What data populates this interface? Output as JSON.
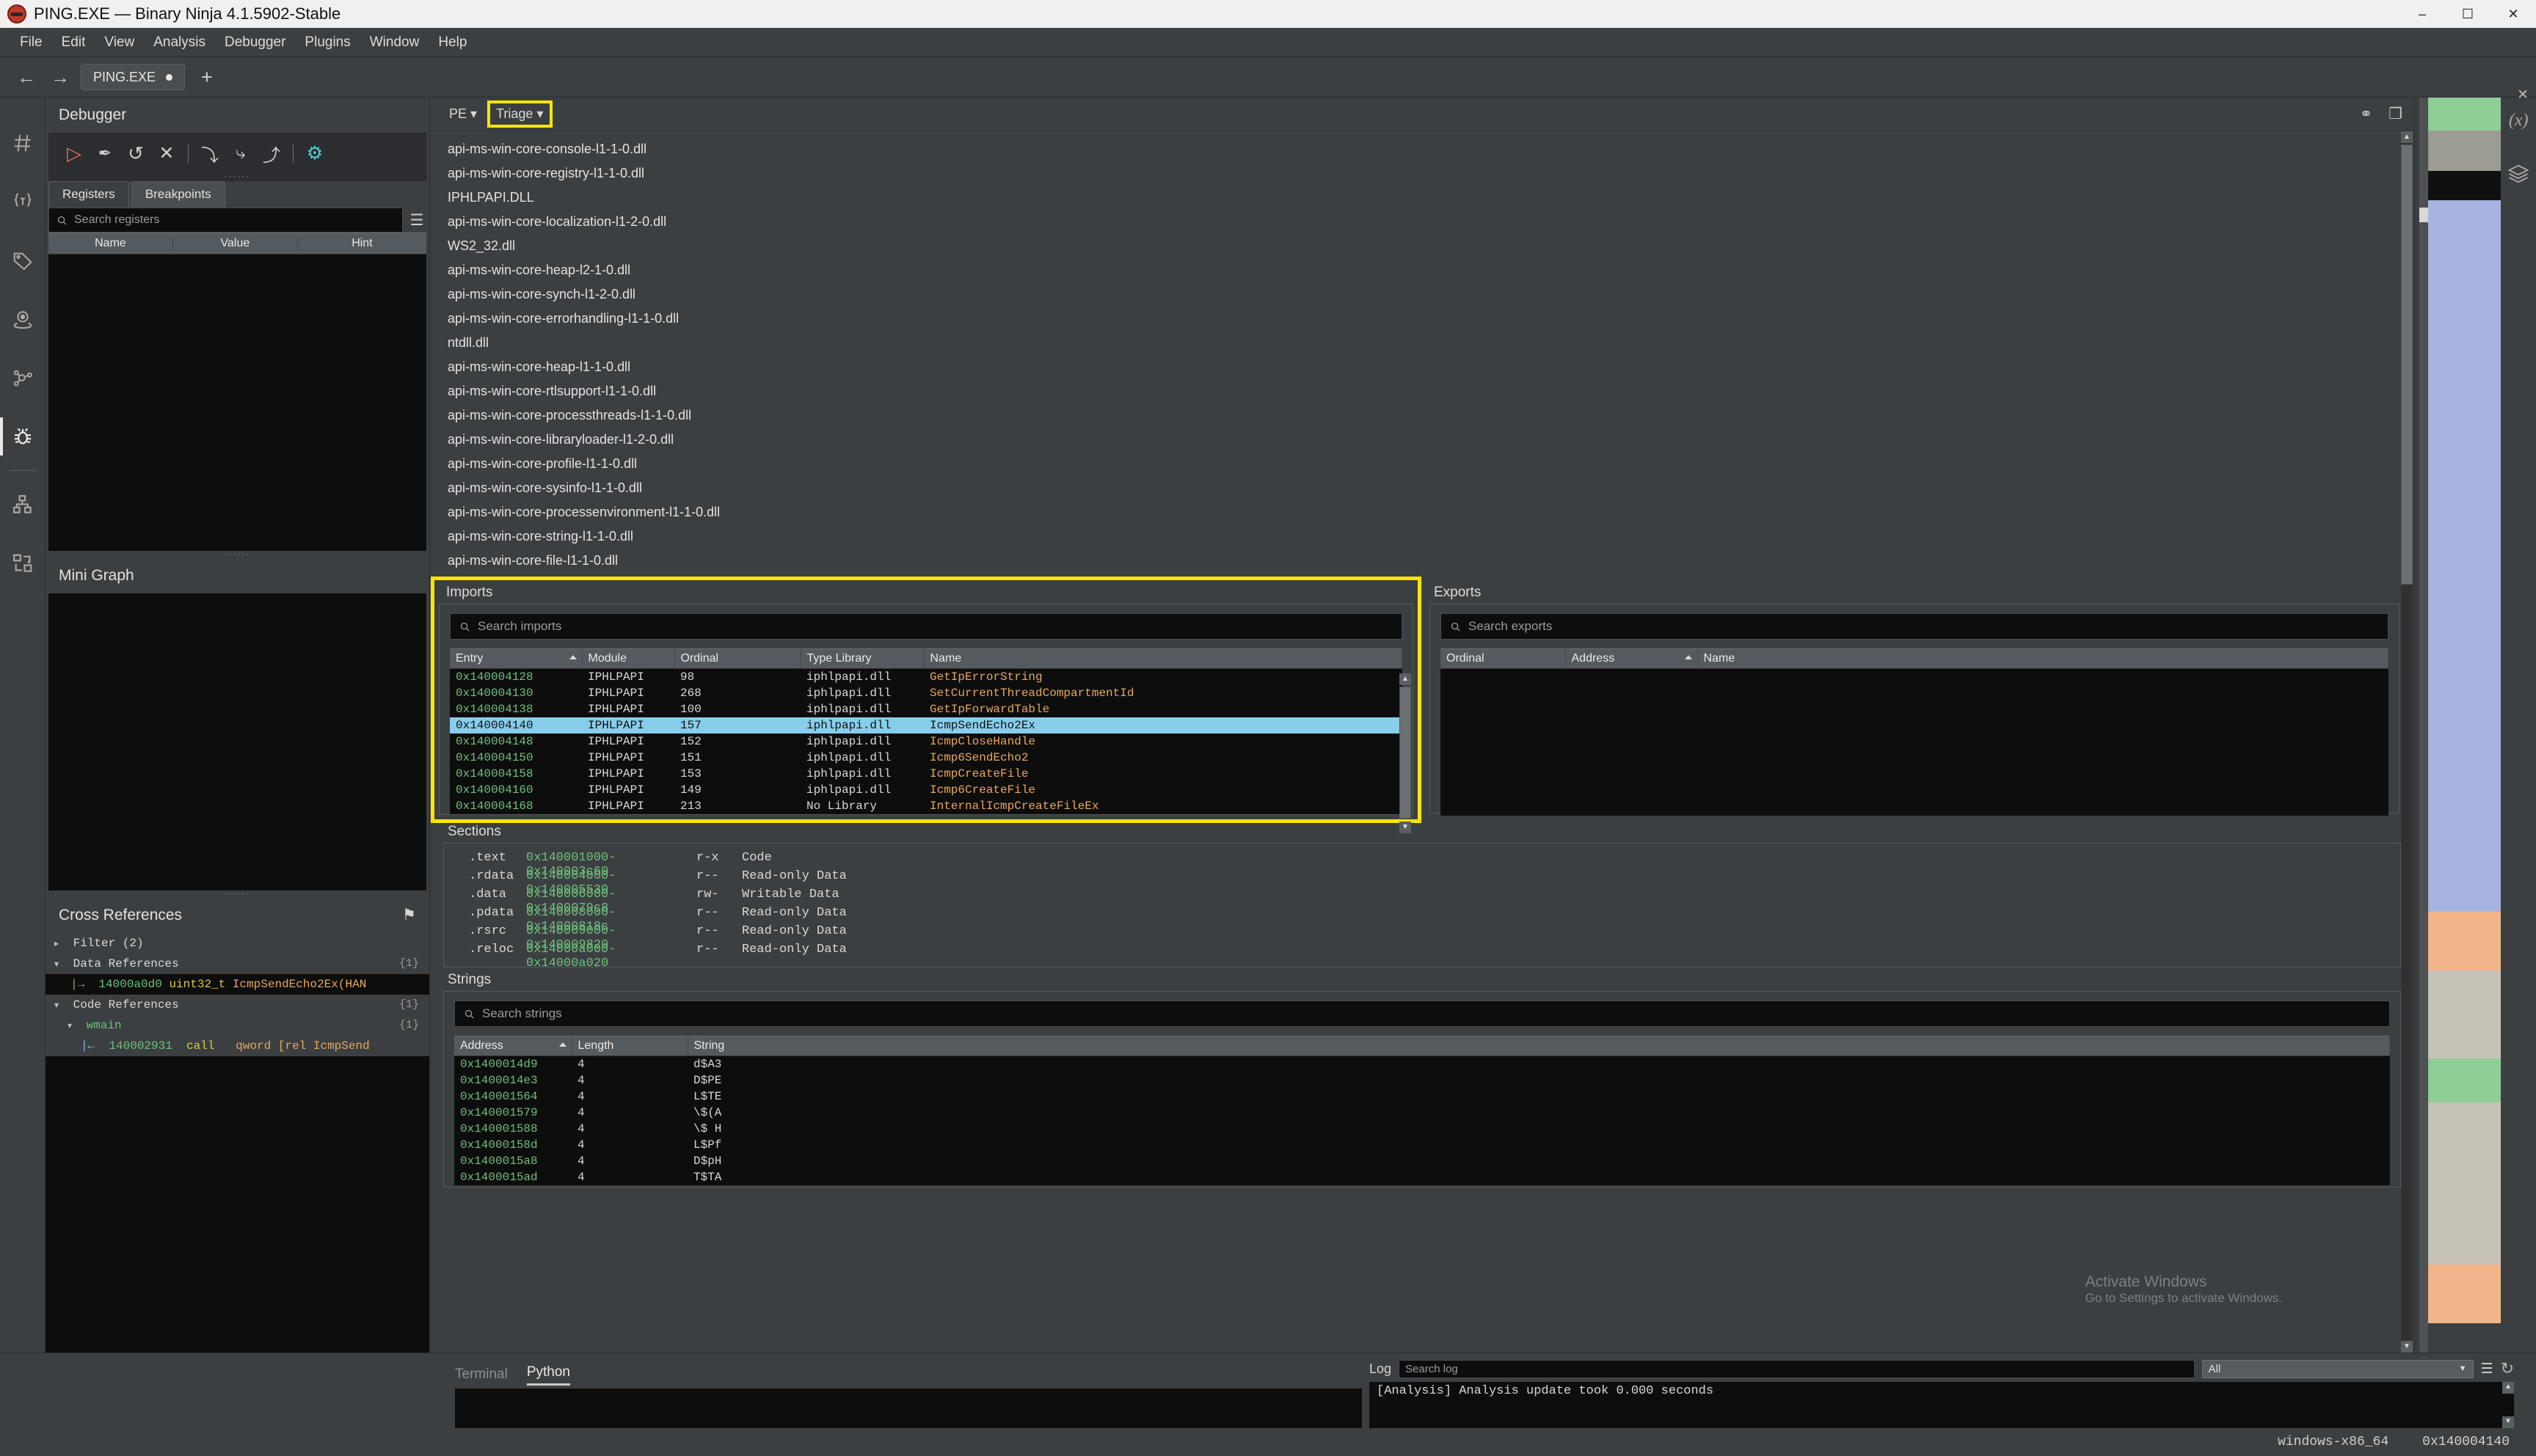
{
  "window": {
    "title": "PING.EXE — Binary Ninja 4.1.5902-Stable",
    "icon": "ninja-logo-icon",
    "minimize": "–",
    "maximize": "☐",
    "close": "✕"
  },
  "menubar": {
    "items": [
      "File",
      "Edit",
      "View",
      "Analysis",
      "Debugger",
      "Plugins",
      "Window",
      "Help"
    ]
  },
  "tabstrip": {
    "back": "←",
    "forward": "→",
    "file_tab": "PING.EXE",
    "new_tab": "+"
  },
  "icon_rail": {
    "items": [
      {
        "name": "symbols-icon",
        "glyph": "♯",
        "active": false
      },
      {
        "name": "types-icon",
        "glyph": "{T}",
        "active": false
      },
      {
        "name": "tags-icon",
        "glyph": "◇",
        "active": false
      },
      {
        "name": "location-icon",
        "glyph": "◎",
        "active": false
      },
      {
        "name": "graph-nodes-icon",
        "glyph": "∴",
        "active": false
      },
      {
        "name": "debugger-icon",
        "glyph": "☣",
        "active": true
      },
      {
        "name": "hierarchy-icon",
        "glyph": "☷",
        "active": false
      },
      {
        "name": "transform-icon",
        "glyph": "⇄",
        "active": false
      }
    ]
  },
  "debugger_panel": {
    "title": "Debugger",
    "toolbar": [
      {
        "name": "run-button",
        "glyph": "▷",
        "color": "#e06c5c"
      },
      {
        "name": "connect-button",
        "glyph": "✒",
        "color": "#d5d5d5"
      },
      {
        "name": "restart-button",
        "glyph": "↺",
        "color": "#cdcdcd"
      },
      {
        "name": "stop-button",
        "glyph": "✕",
        "color": "#cdcdcd"
      },
      {
        "name": "step-into-button",
        "glyph": "⤵",
        "color": "#cdcdcd"
      },
      {
        "name": "step-over-button",
        "glyph": "⤷",
        "color": "#cdcdcd"
      },
      {
        "name": "step-out-button",
        "glyph": "⤴",
        "color": "#cdcdcd"
      },
      {
        "name": "settings-gear-button",
        "glyph": "⚙",
        "color": "#4fd0d0"
      }
    ],
    "tabs": [
      {
        "label": "Registers",
        "selected": true
      },
      {
        "label": "Breakpoints",
        "selected": false
      }
    ],
    "search_placeholder": "Search registers",
    "menu_glyph": "☰",
    "columns": [
      "Name",
      "Value",
      "Hint"
    ],
    "rows": []
  },
  "mini_graph": {
    "title": "Mini Graph"
  },
  "cross_references": {
    "title": "Cross References",
    "pin_icon": "⚑",
    "filter_label": "Filter",
    "filter_count": "(2)",
    "groups": [
      {
        "label": "Data References",
        "count": "{1}",
        "rows": [
          {
            "arrow": "|→",
            "address": "14000a0d0",
            "type": "uint32_t",
            "symbol": "IcmpSendEcho2Ex(HAN",
            "selected": true
          }
        ]
      },
      {
        "label": "Code References",
        "count": "{1}",
        "subgroup": "wmain",
        "subgroup_count": "{1}",
        "rows": [
          {
            "arrow": "|←",
            "address": "140002931",
            "mnemonic": "call",
            "operand": "qword [rel IcmpSend",
            "selected": false
          }
        ]
      }
    ]
  },
  "view_bar": {
    "view_type": "PE",
    "view_type_caret": "▾",
    "view_mode": "Triage",
    "view_mode_caret": "▾",
    "view_mode_highlighted": true,
    "link_icon": "⚭",
    "split_icon": "❐"
  },
  "triage": {
    "libraries": [
      "api-ms-win-core-console-l1-1-0.dll",
      "api-ms-win-core-registry-l1-1-0.dll",
      "IPHLPAPI.DLL",
      "api-ms-win-core-localization-l1-2-0.dll",
      "WS2_32.dll",
      "api-ms-win-core-heap-l2-1-0.dll",
      "api-ms-win-core-synch-l1-2-0.dll",
      "api-ms-win-core-errorhandling-l1-1-0.dll",
      "ntdll.dll",
      "api-ms-win-core-heap-l1-1-0.dll",
      "api-ms-win-core-rtlsupport-l1-1-0.dll",
      "api-ms-win-core-processthreads-l1-1-0.dll",
      "api-ms-win-core-libraryloader-l1-2-0.dll",
      "api-ms-win-core-profile-l1-1-0.dll",
      "api-ms-win-core-sysinfo-l1-1-0.dll",
      "api-ms-win-core-processenvironment-l1-1-0.dll",
      "api-ms-win-core-string-l1-1-0.dll",
      "api-ms-win-core-file-l1-1-0.dll"
    ],
    "imports": {
      "title": "Imports",
      "highlighted": true,
      "search_placeholder": "Search imports",
      "columns": [
        "Entry",
        "Module",
        "Ordinal",
        "Type Library",
        "Name"
      ],
      "sorted_column": "Entry",
      "rows": [
        {
          "entry": "0x140004128",
          "module": "IPHLPAPI",
          "ordinal": "98",
          "typelib": "iphlpapi.dll",
          "name": "GetIpErrorString",
          "selected": false
        },
        {
          "entry": "0x140004130",
          "module": "IPHLPAPI",
          "ordinal": "268",
          "typelib": "iphlpapi.dll",
          "name": "SetCurrentThreadCompartmentId",
          "selected": false
        },
        {
          "entry": "0x140004138",
          "module": "IPHLPAPI",
          "ordinal": "100",
          "typelib": "iphlpapi.dll",
          "name": "GetIpForwardTable",
          "selected": false
        },
        {
          "entry": "0x140004140",
          "module": "IPHLPAPI",
          "ordinal": "157",
          "typelib": "iphlpapi.dll",
          "name": "IcmpSendEcho2Ex",
          "selected": true
        },
        {
          "entry": "0x140004148",
          "module": "IPHLPAPI",
          "ordinal": "152",
          "typelib": "iphlpapi.dll",
          "name": "IcmpCloseHandle",
          "selected": false
        },
        {
          "entry": "0x140004150",
          "module": "IPHLPAPI",
          "ordinal": "151",
          "typelib": "iphlpapi.dll",
          "name": "Icmp6SendEcho2",
          "selected": false
        },
        {
          "entry": "0x140004158",
          "module": "IPHLPAPI",
          "ordinal": "153",
          "typelib": "iphlpapi.dll",
          "name": "IcmpCreateFile",
          "selected": false
        },
        {
          "entry": "0x140004160",
          "module": "IPHLPAPI",
          "ordinal": "149",
          "typelib": "iphlpapi.dll",
          "name": "Icmp6CreateFile",
          "selected": false
        },
        {
          "entry": "0x140004168",
          "module": "IPHLPAPI",
          "ordinal": "213",
          "typelib": "No Library",
          "name": "InternalIcmpCreateFileEx",
          "selected": false
        }
      ]
    },
    "exports": {
      "title": "Exports",
      "search_placeholder": "Search exports",
      "columns": [
        "Ordinal",
        "Address",
        "Name"
      ],
      "sorted_column": "Address",
      "rows": []
    },
    "sections": {
      "title": "Sections",
      "rows": [
        {
          "name": ".text",
          "range": "0x140001000-0x140003c60",
          "perms": "r-x",
          "desc": "Code"
        },
        {
          "name": ".rdata",
          "range": "0x140004000-0x140005530",
          "perms": "r--",
          "desc": "Read-only Data"
        },
        {
          "name": ".data",
          "range": "0x140006000-0x1400079c8",
          "perms": "rw-",
          "desc": "Writable Data"
        },
        {
          "name": ".pdata",
          "range": "0x140008000-0x14000818c",
          "perms": "r--",
          "desc": "Read-only Data"
        },
        {
          "name": ".rsrc",
          "range": "0x140009000-0x140009820",
          "perms": "r--",
          "desc": "Read-only Data"
        },
        {
          "name": ".reloc",
          "range": "0x14000a000-0x14000a020",
          "perms": "r--",
          "desc": "Read-only Data"
        }
      ]
    },
    "strings": {
      "title": "Strings",
      "search_placeholder": "Search strings",
      "columns": [
        "Address",
        "Length",
        "String"
      ],
      "sorted_column": "Address",
      "rows": [
        {
          "address": "0x1400014d9",
          "length": "4",
          "string": "d$A3"
        },
        {
          "address": "0x1400014e3",
          "length": "4",
          "string": "D$PE"
        },
        {
          "address": "0x140001564",
          "length": "4",
          "string": "L$TE"
        },
        {
          "address": "0x140001579",
          "length": "4",
          "string": "\\$(A"
        },
        {
          "address": "0x140001588",
          "length": "4",
          "string": "\\$ H"
        },
        {
          "address": "0x14000158d",
          "length": "4",
          "string": "L$Pf"
        },
        {
          "address": "0x1400015a8",
          "length": "4",
          "string": "D$pH"
        },
        {
          "address": "0x1400015ad",
          "length": "4",
          "string": "T$TA"
        }
      ]
    }
  },
  "right_rail": {
    "items": [
      {
        "name": "variables-icon",
        "glyph": "(x)"
      },
      {
        "name": "layers-icon",
        "glyph": "☰"
      },
      {
        "name": "close-sidebar-icon",
        "glyph": "✕"
      }
    ]
  },
  "bottom": {
    "tabs": [
      {
        "label": "Terminal",
        "selected": false
      },
      {
        "label": "Python",
        "selected": true
      }
    ],
    "log_label": "Log",
    "log_search_placeholder": "Search log",
    "log_filter": "All",
    "log_filter_caret": "▼",
    "log_menu_glyph": "☰",
    "log_history_glyph": "↻",
    "log_lines": [
      "[Analysis] Analysis update took 0.000 seconds"
    ]
  },
  "status_bar": {
    "platform": "windows-x86_64",
    "address": "0x140004140"
  },
  "watermark": {
    "line1": "Activate Windows",
    "line2": "Go to Settings to activate Windows."
  },
  "colors": {
    "highlight_yellow": "#ffe600",
    "selection_blue": "#87ceeb",
    "address_green": "#6ec07c",
    "symbol_orange": "#e8a75c"
  }
}
